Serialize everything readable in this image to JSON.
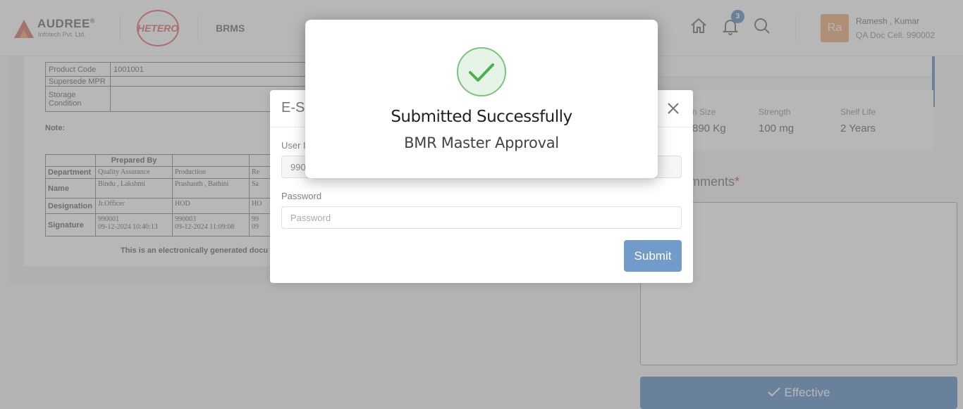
{
  "header": {
    "company_logo": "AUDREE",
    "company_logo_sub": "Infotech Pvt. Ltd.",
    "client_logo": "HETERO",
    "app_name": "BRMS",
    "notification_count": "3",
    "user": {
      "initials": "Ra",
      "name": "Ramesh , Kumar",
      "role": "QA Doc Cell. 990002"
    },
    "icons": [
      "home-icon",
      "bell-icon",
      "search-icon"
    ]
  },
  "document": {
    "info_rows": [
      {
        "label": "Product Code",
        "value": "1001001"
      },
      {
        "label": "Supersede MPR",
        "value": ""
      },
      {
        "label": "Storage Condition",
        "value": ""
      }
    ],
    "note_label": "Note:",
    "prepared_by_header": "Prepared By",
    "rows": {
      "department": {
        "label": "Department",
        "values": [
          "Quality Assurance",
          "Production",
          "Re"
        ]
      },
      "name": {
        "label": "Name",
        "values": [
          "Bindu , Lakshmi",
          "Prashanth , Bathini",
          "Sa"
        ]
      },
      "designation": {
        "label": "Designation",
        "values": [
          "Jr.Officer",
          "HOD",
          "HO"
        ]
      },
      "signature": {
        "label": "Signature",
        "values": [
          "990001",
          "09-12-2024 10:40:13",
          "990003",
          "09-12-2024 11:09:08",
          "99",
          "09"
        ]
      }
    },
    "footer": "This is an electronically generated docu"
  },
  "specs": [
    {
      "label": "n Size",
      "value": "890 Kg"
    },
    {
      "label": "Strength",
      "value": "100 mg"
    },
    {
      "label": "Shelf Life",
      "value": "2 Years"
    }
  ],
  "comments": {
    "title": "omments",
    "required_mark": "*"
  },
  "effective_button": "Effective",
  "esign": {
    "title": "E-S",
    "user_label": "User I",
    "user_value": "990",
    "password_label": "Password",
    "password_placeholder": "Password",
    "submit_label": "Submit"
  },
  "success": {
    "title": "Submitted Successfully",
    "subtitle": "BMR Master Approval"
  },
  "colors": {
    "primary": "#1a5fa8",
    "success_green": "#4caf50",
    "hetero_red": "#d42b2b",
    "avatar_orange": "#e8893c"
  }
}
